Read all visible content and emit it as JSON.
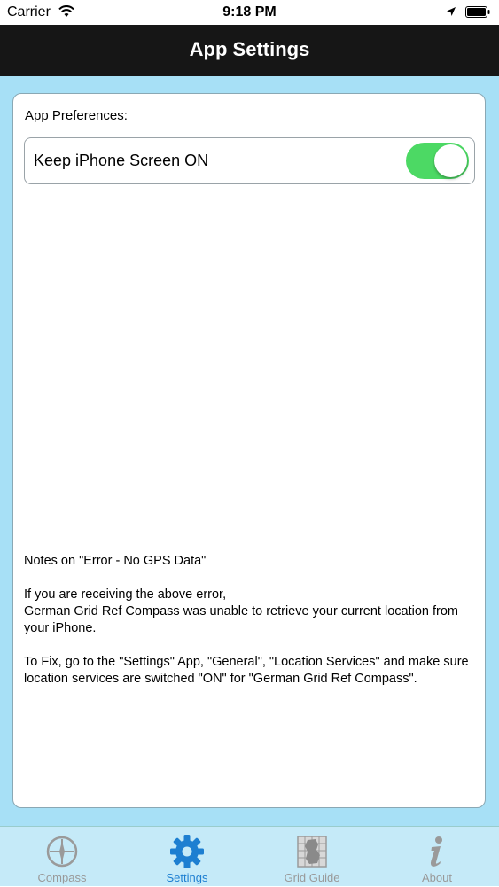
{
  "status_bar": {
    "carrier": "Carrier",
    "time": "9:18 PM"
  },
  "nav": {
    "title": "App Settings"
  },
  "preferences": {
    "section_label": "App Preferences:",
    "keep_screen_on": {
      "label": "Keep iPhone Screen ON",
      "enabled": true
    }
  },
  "notes": {
    "heading": "Notes on \"Error - No GPS Data\"",
    "line1": "If you are receiving the above error,",
    "line2": "German Grid Ref Compass was unable to retrieve your current location from your iPhone.",
    "fix": "To Fix, go to the \"Settings\" App, \"General\", \"Location Services\" and make sure location services are switched \"ON\" for \"German Grid Ref Compass\"."
  },
  "tab_bar": {
    "tabs": [
      {
        "label": "Compass",
        "icon": "compass-icon",
        "active": false
      },
      {
        "label": "Settings",
        "icon": "gear-icon",
        "active": true
      },
      {
        "label": "Grid Guide",
        "icon": "grid-map-icon",
        "active": false
      },
      {
        "label": "About",
        "icon": "info-icon",
        "active": false
      }
    ]
  },
  "colors": {
    "background": "#a7e0f6",
    "nav_bar": "#161616",
    "toggle_on": "#4cd964",
    "tab_active": "#1d7fd1",
    "tab_inactive": "#999999"
  }
}
